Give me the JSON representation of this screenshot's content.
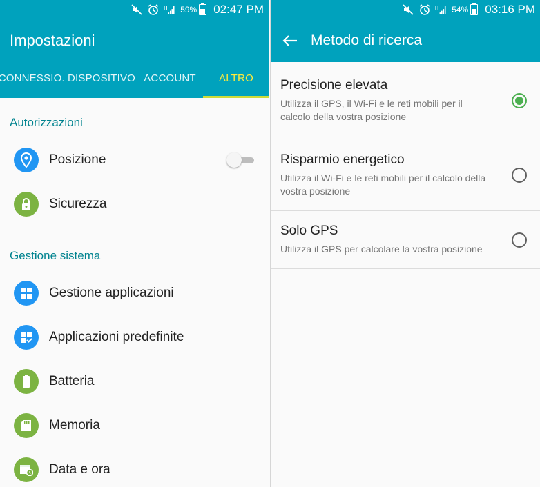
{
  "left": {
    "status": {
      "battery": "59%",
      "time": "02:47 PM"
    },
    "title": "Impostazioni",
    "tabs": [
      "CONNESSIO..",
      "DISPOSITIVO",
      "ACCOUNT",
      "ALTRO"
    ],
    "sections": [
      {
        "header": "Autorizzazioni",
        "items": [
          {
            "label": "Posizione",
            "icon": "location-pin-icon",
            "color": "#2196f3",
            "toggle": "off"
          },
          {
            "label": "Sicurezza",
            "icon": "lock-icon",
            "color": "#7cb342"
          }
        ]
      },
      {
        "header": "Gestione sistema",
        "items": [
          {
            "label": "Gestione applicazioni",
            "icon": "apps-grid-icon",
            "color": "#2196f3"
          },
          {
            "label": "Applicazioni predefinite",
            "icon": "default-apps-icon",
            "color": "#2196f3"
          },
          {
            "label": "Batteria",
            "icon": "battery-icon",
            "color": "#7cb342"
          },
          {
            "label": "Memoria",
            "icon": "sd-card-icon",
            "color": "#7cb342"
          },
          {
            "label": "Data e ora",
            "icon": "calendar-clock-icon",
            "color": "#7cb342"
          }
        ]
      }
    ]
  },
  "right": {
    "status": {
      "battery": "54%",
      "time": "03:16 PM"
    },
    "title": "Metodo di ricerca",
    "options": [
      {
        "title": "Precisione elevata",
        "desc1": "Utilizza il GPS, il Wi-Fi e le reti mobili per il",
        "desc2": "calcolo della vostra posizione",
        "selected": true
      },
      {
        "title": "Risparmio energetico",
        "desc1": "Utilizza il Wi-Fi e le reti mobili per il calcolo della",
        "desc2": "vostra posizione",
        "selected": false
      },
      {
        "title": "Solo GPS",
        "desc1": "Utilizza il GPS per calcolare la vostra posizione",
        "desc2": "",
        "selected": false
      }
    ]
  },
  "colors": {
    "accent": "#00a2bd",
    "tab_active": "#ffeb3b",
    "section_header": "#00838f",
    "radio_on": "#4caf50"
  }
}
